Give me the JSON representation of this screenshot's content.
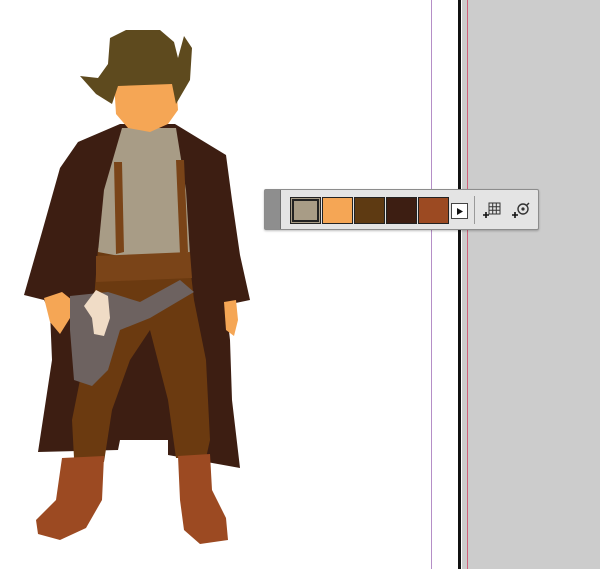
{
  "canvas": {
    "artboard_color": "#ffffff",
    "pasteboard_color": "#cccccc"
  },
  "figure": {
    "icon": "cowboy-figure-icon",
    "colors": {
      "hat": "#5e4a1e",
      "skin": "#f5a655",
      "shirt": "#a89c86",
      "coat": "#3d1e12",
      "pants": "#6b3a10",
      "suspenders": "#7a4418",
      "belt": "#7a4418",
      "holster": "#6d6260",
      "grip": "#f0dcc6",
      "boots": "#9c4a22"
    }
  },
  "swatch_panel": {
    "swatches": [
      {
        "color": "#a89c86",
        "selected": true
      },
      {
        "color": "#f5a655",
        "selected": false
      },
      {
        "color": "#5e3a12",
        "selected": false
      },
      {
        "color": "#3d1e12",
        "selected": false
      },
      {
        "color": "#9c4a22",
        "selected": false
      }
    ],
    "icons": {
      "more": "play-triangle-icon",
      "add": "add-to-swatches-icon",
      "group": "color-group-icon"
    }
  }
}
